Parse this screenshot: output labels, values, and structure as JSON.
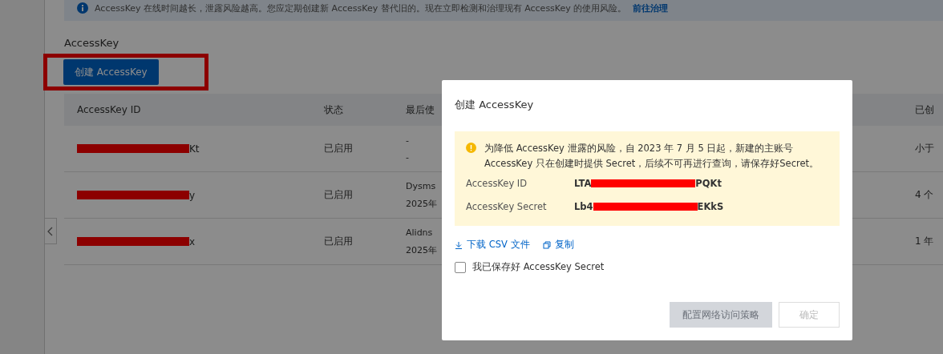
{
  "banner": {
    "text": "AccessKey 在线时间越长，泄露风险越高。您应定期创建新 AccessKey 替代旧的。现在立即检测和治理现有 AccessKey 的使用风险。",
    "link": "前往治理"
  },
  "section_title": "AccessKey",
  "create_button": "创建 AccessKey",
  "table": {
    "columns": [
      "AccessKey ID",
      "状态",
      "最后使",
      "已创"
    ],
    "rows": [
      {
        "id_visible_end": "Kt",
        "status": "已启用",
        "last_used": [
          "-",
          "-"
        ],
        "created": "小于"
      },
      {
        "id_visible_end": "y",
        "status": "已启用",
        "last_used": [
          "Dysms",
          "2025年"
        ],
        "created": "4 个"
      },
      {
        "id_visible_end": "x",
        "status": "已启用",
        "last_used": [
          "Alidns",
          "2025年"
        ],
        "created": "1 年"
      }
    ]
  },
  "dialog": {
    "title": "创建 AccessKey",
    "notice": "为降低 AccessKey 泄露的风险，自 2023 年 7 月 5 日起，新建的主账号 AccessKey 只在创建时提供 Secret，后续不可再进行查询，请保存好Secret。",
    "fields": [
      {
        "label": "AccessKey ID",
        "value_start": "LTA",
        "value_end": "PQKt"
      },
      {
        "label": "AccessKey Secret",
        "value_start": "Lb4",
        "value_end": "EKkS"
      }
    ],
    "links": [
      {
        "kind": "download",
        "label": "下载 CSV 文件"
      },
      {
        "kind": "copy",
        "label": "复制"
      }
    ],
    "confirm_checkbox": {
      "label": "我已保存好 AccessKey Secret",
      "checked": false
    },
    "buttons": [
      {
        "label": "配置网络访问策略",
        "kind": "primary",
        "disabled": true
      },
      {
        "label": "确定",
        "kind": "secondary",
        "disabled": true
      }
    ]
  }
}
